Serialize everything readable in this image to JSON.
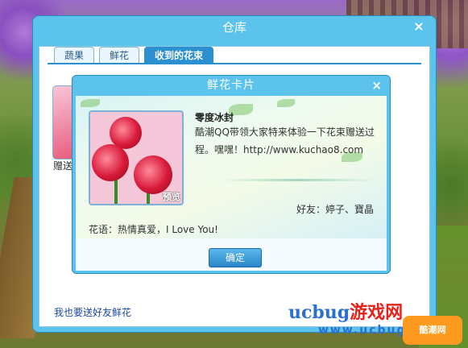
{
  "warehouse": {
    "title": "仓库",
    "close_glyph": "×",
    "tabs": [
      {
        "label": "蔬果",
        "active": false
      },
      {
        "label": "鲜花",
        "active": false
      },
      {
        "label": "收到的花束",
        "active": true
      }
    ],
    "item_label": "赠送",
    "send_link": "我也要送好友鲜花"
  },
  "card": {
    "title": "鲜花卡片",
    "close_glyph": "×",
    "sender": "零度冰封",
    "message": "酷潮QQ带领大家特来体验一下花束赠送过程。嘿嘿！http://www.kuchao8.com",
    "preview_label": "预览",
    "friends": "好友：婷子、寶晶",
    "flower_words": "花语：热情真爱，I Love You!",
    "ok_label": "确定"
  },
  "watermark": {
    "line1_latin": "ucbug",
    "line1_cn": "游戏网",
    "line2": "www.ucbug.com",
    "badge": "酷潮网"
  },
  "colors": {
    "window_blue": "#5cc3ec",
    "tab_active": "#2b8fd0",
    "link": "#1a4aa0"
  }
}
